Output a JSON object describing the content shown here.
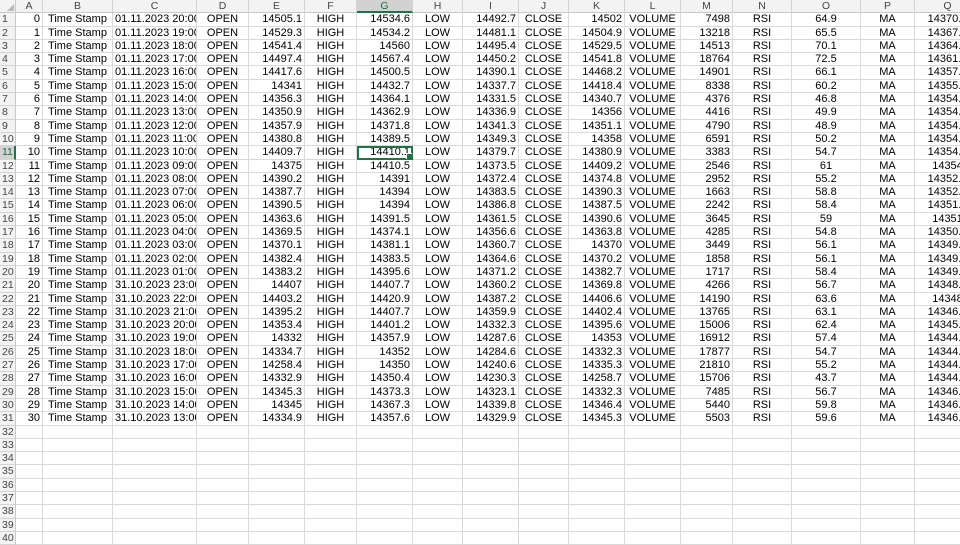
{
  "columns": [
    "A",
    "B",
    "C",
    "D",
    "E",
    "F",
    "G",
    "H",
    "I",
    "J",
    "K",
    "L",
    "M",
    "N",
    "O",
    "P",
    "Q"
  ],
  "active_column": "G",
  "active_row": 11,
  "active_cell": {
    "row": 11,
    "col": "G"
  },
  "row_count": 40,
  "rows": [
    [
      "0",
      "Time Stamp",
      "01.11.2023 20:00",
      "OPEN",
      "14505.1",
      "HIGH",
      "14534.6",
      "LOW",
      "14492.7",
      "CLOSE",
      "14502",
      "VOLUME",
      "7498",
      "RSI",
      "64.9",
      "MA",
      "14370.2"
    ],
    [
      "1",
      "Time Stamp",
      "01.11.2023 19:00",
      "OPEN",
      "14529.3",
      "HIGH",
      "14534.2",
      "LOW",
      "14481.1",
      "CLOSE",
      "14504.9",
      "VOLUME",
      "13218",
      "RSI",
      "65.5",
      "MA",
      "14367.5"
    ],
    [
      "2",
      "Time Stamp",
      "01.11.2023 18:00",
      "OPEN",
      "14541.4",
      "HIGH",
      "14560",
      "LOW",
      "14495.4",
      "CLOSE",
      "14529.5",
      "VOLUME",
      "14513",
      "RSI",
      "70.1",
      "MA",
      "14364.8"
    ],
    [
      "3",
      "Time Stamp",
      "01.11.2023 17:00",
      "OPEN",
      "14497.4",
      "HIGH",
      "14567.4",
      "LOW",
      "14450.2",
      "CLOSE",
      "14541.8",
      "VOLUME",
      "18764",
      "RSI",
      "72.5",
      "MA",
      "14361.4"
    ],
    [
      "4",
      "Time Stamp",
      "01.11.2023 16:00",
      "OPEN",
      "14417.6",
      "HIGH",
      "14500.5",
      "LOW",
      "14390.1",
      "CLOSE",
      "14468.2",
      "VOLUME",
      "14901",
      "RSI",
      "66.1",
      "MA",
      "14357.8"
    ],
    [
      "5",
      "Time Stamp",
      "01.11.2023 15:00",
      "OPEN",
      "14341",
      "HIGH",
      "14432.7",
      "LOW",
      "14337.7",
      "CLOSE",
      "14418.4",
      "VOLUME",
      "8338",
      "RSI",
      "60.2",
      "MA",
      "14355.6"
    ],
    [
      "6",
      "Time Stamp",
      "01.11.2023 14:00",
      "OPEN",
      "14356.3",
      "HIGH",
      "14364.1",
      "LOW",
      "14331.5",
      "CLOSE",
      "14340.7",
      "VOLUME",
      "4376",
      "RSI",
      "46.8",
      "MA",
      "14354.3"
    ],
    [
      "7",
      "Time Stamp",
      "01.11.2023 13:00",
      "OPEN",
      "14350.9",
      "HIGH",
      "14362.9",
      "LOW",
      "14336.9",
      "CLOSE",
      "14356",
      "VOLUME",
      "4416",
      "RSI",
      "49.9",
      "MA",
      "14354.6"
    ],
    [
      "8",
      "Time Stamp",
      "01.11.2023 12:00",
      "OPEN",
      "14357.9",
      "HIGH",
      "14371.8",
      "LOW",
      "14341.3",
      "CLOSE",
      "14351.1",
      "VOLUME",
      "4790",
      "RSI",
      "48.9",
      "MA",
      "14354.5"
    ],
    [
      "9",
      "Time Stamp",
      "01.11.2023 11:00",
      "OPEN",
      "14380.8",
      "HIGH",
      "14389.5",
      "LOW",
      "14349.3",
      "CLOSE",
      "14358",
      "VOLUME",
      "6591",
      "RSI",
      "50.2",
      "MA",
      "14354.6"
    ],
    [
      "10",
      "Time Stamp",
      "01.11.2023 10:00",
      "OPEN",
      "14409.7",
      "HIGH",
      "14410.1",
      "LOW",
      "14379.7",
      "CLOSE",
      "14380.9",
      "VOLUME",
      "3383",
      "RSI",
      "54.7",
      "MA",
      "14354.5"
    ],
    [
      "11",
      "Time Stamp",
      "01.11.2023 09:00",
      "OPEN",
      "14375",
      "HIGH",
      "14410.5",
      "LOW",
      "14373.5",
      "CLOSE",
      "14409.2",
      "VOLUME",
      "2546",
      "RSI",
      "61",
      "MA",
      "14354"
    ],
    [
      "12",
      "Time Stamp",
      "01.11.2023 08:00",
      "OPEN",
      "14390.2",
      "HIGH",
      "14391",
      "LOW",
      "14372.4",
      "CLOSE",
      "14374.8",
      "VOLUME",
      "2952",
      "RSI",
      "55.2",
      "MA",
      "14352.9"
    ],
    [
      "13",
      "Time Stamp",
      "01.11.2023 07:00",
      "OPEN",
      "14387.7",
      "HIGH",
      "14394",
      "LOW",
      "14383.5",
      "CLOSE",
      "14390.3",
      "VOLUME",
      "1663",
      "RSI",
      "58.8",
      "MA",
      "14352.5"
    ],
    [
      "14",
      "Time Stamp",
      "01.11.2023 06:00",
      "OPEN",
      "14390.5",
      "HIGH",
      "14394",
      "LOW",
      "14386.8",
      "CLOSE",
      "14387.5",
      "VOLUME",
      "2242",
      "RSI",
      "58.4",
      "MA",
      "14351.7"
    ],
    [
      "15",
      "Time Stamp",
      "01.11.2023 05:00",
      "OPEN",
      "14363.6",
      "HIGH",
      "14391.5",
      "LOW",
      "14361.5",
      "CLOSE",
      "14390.6",
      "VOLUME",
      "3645",
      "RSI",
      "59",
      "MA",
      "14351"
    ],
    [
      "16",
      "Time Stamp",
      "01.11.2023 04:00",
      "OPEN",
      "14369.5",
      "HIGH",
      "14374.1",
      "LOW",
      "14356.6",
      "CLOSE",
      "14363.8",
      "VOLUME",
      "4285",
      "RSI",
      "54.8",
      "MA",
      "14350.2"
    ],
    [
      "17",
      "Time Stamp",
      "01.11.2023 03:00",
      "OPEN",
      "14370.1",
      "HIGH",
      "14381.1",
      "LOW",
      "14360.7",
      "CLOSE",
      "14370",
      "VOLUME",
      "3449",
      "RSI",
      "56.1",
      "MA",
      "14349.9"
    ],
    [
      "18",
      "Time Stamp",
      "01.11.2023 02:00",
      "OPEN",
      "14382.4",
      "HIGH",
      "14383.5",
      "LOW",
      "14364.6",
      "CLOSE",
      "14370.2",
      "VOLUME",
      "1858",
      "RSI",
      "56.1",
      "MA",
      "14349.5"
    ],
    [
      "19",
      "Time Stamp",
      "01.11.2023 01:00",
      "OPEN",
      "14383.2",
      "HIGH",
      "14395.6",
      "LOW",
      "14371.2",
      "CLOSE",
      "14382.7",
      "VOLUME",
      "1717",
      "RSI",
      "58.4",
      "MA",
      "14349.1"
    ],
    [
      "20",
      "Time Stamp",
      "31.10.2023 23:00",
      "OPEN",
      "14407",
      "HIGH",
      "14407.7",
      "LOW",
      "14360.2",
      "CLOSE",
      "14369.8",
      "VOLUME",
      "4266",
      "RSI",
      "56.7",
      "MA",
      "14348.4"
    ],
    [
      "21",
      "Time Stamp",
      "31.10.2023 22:00",
      "OPEN",
      "14403.2",
      "HIGH",
      "14420.9",
      "LOW",
      "14387.2",
      "CLOSE",
      "14406.6",
      "VOLUME",
      "14190",
      "RSI",
      "63.6",
      "MA",
      "14348"
    ],
    [
      "22",
      "Time Stamp",
      "31.10.2023 21:00",
      "OPEN",
      "14395.2",
      "HIGH",
      "14407.7",
      "LOW",
      "14359.9",
      "CLOSE",
      "14402.4",
      "VOLUME",
      "13765",
      "RSI",
      "63.1",
      "MA",
      "14346.8"
    ],
    [
      "23",
      "Time Stamp",
      "31.10.2023 20:00",
      "OPEN",
      "14353.4",
      "HIGH",
      "14401.2",
      "LOW",
      "14332.3",
      "CLOSE",
      "14395.6",
      "VOLUME",
      "15006",
      "RSI",
      "62.4",
      "MA",
      "14345.6"
    ],
    [
      "24",
      "Time Stamp",
      "31.10.2023 19:00",
      "OPEN",
      "14332",
      "HIGH",
      "14357.9",
      "LOW",
      "14287.6",
      "CLOSE",
      "14353",
      "VOLUME",
      "16912",
      "RSI",
      "57.4",
      "MA",
      "14344.6"
    ],
    [
      "25",
      "Time Stamp",
      "31.10.2023 18:00",
      "OPEN",
      "14334.7",
      "HIGH",
      "14352",
      "LOW",
      "14284.6",
      "CLOSE",
      "14332.3",
      "VOLUME",
      "17877",
      "RSI",
      "54.7",
      "MA",
      "14344.5"
    ],
    [
      "26",
      "Time Stamp",
      "31.10.2023 17:00",
      "OPEN",
      "14258.4",
      "HIGH",
      "14350",
      "LOW",
      "14240.6",
      "CLOSE",
      "14335.3",
      "VOLUME",
      "21810",
      "RSI",
      "55.2",
      "MA",
      "14344.7"
    ],
    [
      "27",
      "Time Stamp",
      "31.10.2023 16:00",
      "OPEN",
      "14332.9",
      "HIGH",
      "14350.4",
      "LOW",
      "14230.3",
      "CLOSE",
      "14258.7",
      "VOLUME",
      "15706",
      "RSI",
      "43.7",
      "MA",
      "14344.9"
    ],
    [
      "28",
      "Time Stamp",
      "31.10.2023 15:00",
      "OPEN",
      "14345.3",
      "HIGH",
      "14373.3",
      "LOW",
      "14323.1",
      "CLOSE",
      "14332.3",
      "VOLUME",
      "7485",
      "RSI",
      "56.7",
      "MA",
      "14346.6"
    ],
    [
      "29",
      "Time Stamp",
      "31.10.2023 14:00",
      "OPEN",
      "14345",
      "HIGH",
      "14367.3",
      "LOW",
      "14339.8",
      "CLOSE",
      "14346.4",
      "VOLUME",
      "5440",
      "RSI",
      "59.8",
      "MA",
      "14346.9"
    ],
    [
      "30",
      "Time Stamp",
      "31.10.2023 13:00",
      "OPEN",
      "14334.9",
      "HIGH",
      "14357.6",
      "LOW",
      "14329.9",
      "CLOSE",
      "14345.3",
      "VOLUME",
      "5503",
      "RSI",
      "59.6",
      "MA",
      "14346.9"
    ]
  ]
}
